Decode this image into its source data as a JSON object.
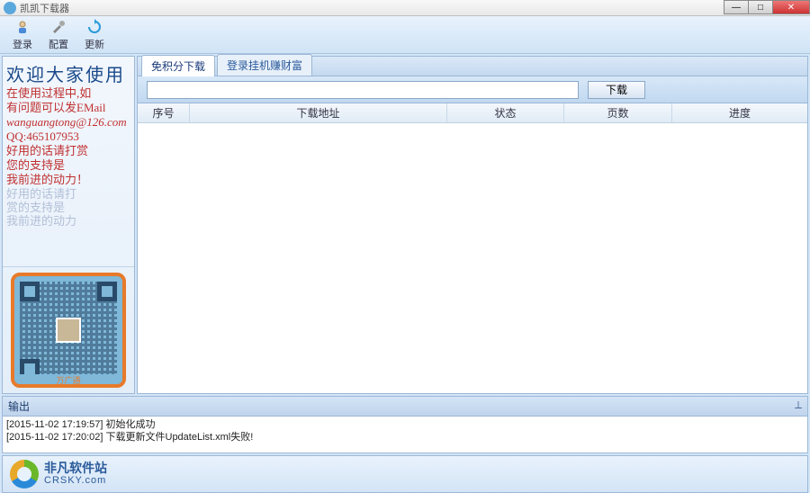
{
  "window": {
    "title": "凯凯下载器"
  },
  "toolbar": {
    "login": "登录",
    "config": "配置",
    "update": "更新"
  },
  "sidebar": {
    "welcome_title": "欢迎大家使用",
    "line1": "在使用过程中,如",
    "line2": "有问题可以发EMail",
    "email": "wanguangtong@126.com",
    "qq": "QQ:465107953",
    "line3": "好用的话请打赏",
    "line4": "您的支持是",
    "line5": "我前进的动力！",
    "ghost1": "好用的话请打",
    "ghost2": "赏的支持是",
    "ghost3": "我前进的动力",
    "qr_label": "万广通"
  },
  "tabs": {
    "free": "免积分下载",
    "earn": "登录挂机赚财富"
  },
  "urlbar": {
    "download_btn": "下载"
  },
  "grid": {
    "col1": "序号",
    "col2": "下载地址",
    "col3": "状态",
    "col4": "页数",
    "col5": "进度"
  },
  "output": {
    "title": "输出",
    "log1": "[2015-11-02 17:19:57] 初始化成功",
    "log2": "[2015-11-02 17:20:02] 下载更新文件UpdateList.xml失败!"
  },
  "footer": {
    "cn": "非凡软件站",
    "en": "CRSKY.com"
  }
}
